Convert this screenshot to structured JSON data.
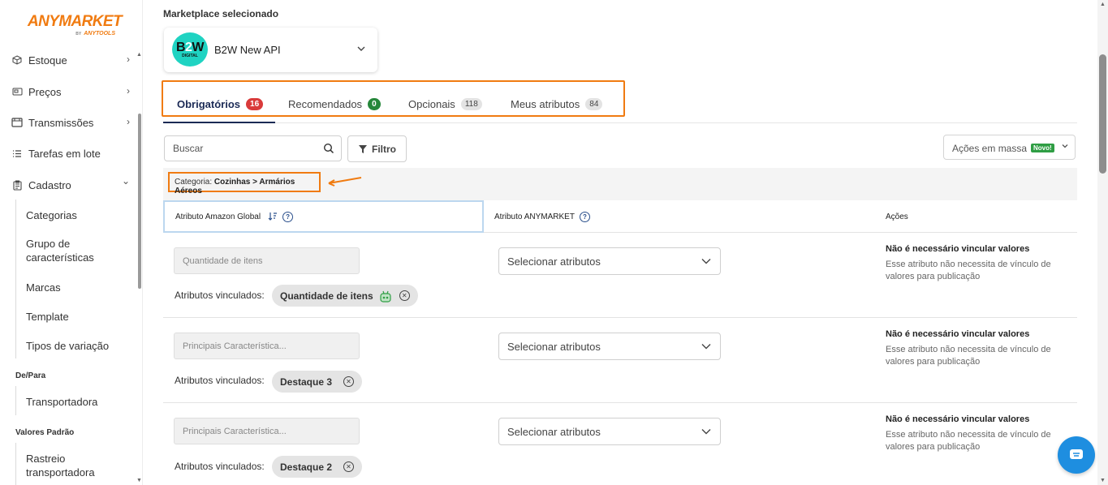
{
  "brand": {
    "name": "ANYMARKET",
    "by": "BY",
    "sub": "ANYTOOLS",
    "color": "#f07b11"
  },
  "sidebar": {
    "nav": [
      {
        "label": "Estoque",
        "icon": "box-icon",
        "chevron": "›"
      },
      {
        "label": "Preços",
        "icon": "price-tag-icon",
        "chevron": "›"
      },
      {
        "label": "Transmissões",
        "icon": "transmission-icon",
        "chevron": "›"
      },
      {
        "label": "Tarefas em lote",
        "icon": "list-icon"
      },
      {
        "label": "Cadastro",
        "icon": "clipboard-icon",
        "chevron": "⌄"
      }
    ],
    "cadastro_items": [
      "Categorias",
      "Grupo de características",
      "Marcas",
      "Template",
      "Tipos de variação"
    ],
    "depara_label": "De/Para",
    "depara_items": [
      "Transportadora"
    ],
    "valores_label": "Valores Padrão",
    "valores_items": [
      "Rastreio transportadora"
    ]
  },
  "marketplace": {
    "label": "Marketplace selecionado",
    "logo_text": "B2W",
    "logo_sub": "DIGITAL",
    "name": "B2W New API"
  },
  "tabs": [
    {
      "label": "Obrigatórios",
      "count": "16",
      "active": true
    },
    {
      "label": "Recomendados",
      "count": "0"
    },
    {
      "label": "Opcionais",
      "count": "118"
    },
    {
      "label": "Meus atributos",
      "count": "84"
    }
  ],
  "toolbar": {
    "search_placeholder": "Buscar",
    "filter_label": "Filtro",
    "mass_actions_label": "Ações em massa",
    "new_badge": "Novo!"
  },
  "category": {
    "prefix": "Categoria:",
    "path": "Cozinhas > Armários Aéreos"
  },
  "table": {
    "headers": [
      "Atributo Amazon Global",
      "Atributo ANYMARKET",
      "Ações"
    ],
    "linked_label": "Atributos vinculados:",
    "rows": [
      {
        "attribute": "Quantidade de itens",
        "select_placeholder": "Selecionar atributos",
        "chip": "Quantidade de itens",
        "chip_has_bot": true,
        "action_title": "Não é necessário vincular valores",
        "action_desc": "Esse atributo não necessita de vínculo de valores para publicação"
      },
      {
        "attribute": "Principais Característica...",
        "select_placeholder": "Selecionar atributos",
        "chip": "Destaque 3",
        "chip_has_bot": false,
        "action_title": "Não é necessário vincular valores",
        "action_desc": "Esse atributo não necessita de vínculo de valores para publicação"
      },
      {
        "attribute": "Principais Característica...",
        "select_placeholder": "Selecionar atributos",
        "chip": "Destaque 2",
        "chip_has_bot": false,
        "action_title": "Não é necessário vincular valores",
        "action_desc": "Esse atributo não necessita de vínculo de valores para publicação"
      }
    ]
  },
  "colors": {
    "accent_orange": "#f07b11",
    "primary_navy": "#1b2a55",
    "chat_blue": "#1e8ee0",
    "badge_red": "#d93a3a",
    "badge_green": "#26873a"
  }
}
